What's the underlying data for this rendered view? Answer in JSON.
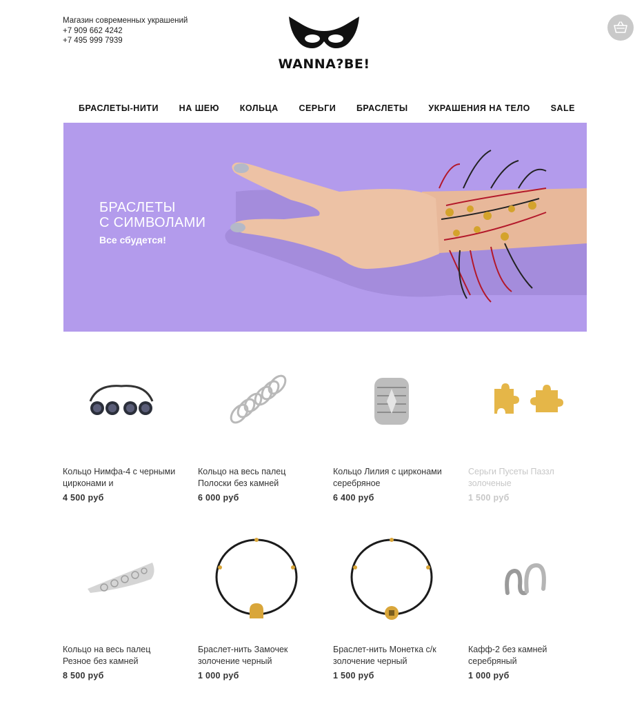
{
  "header": {
    "tagline": "Магазин современных украшений",
    "phone1": "+7 909 662 4242",
    "phone2": "+7 495 999 7939",
    "brand": "WANNA?BE!",
    "cart_icon": "basket-icon"
  },
  "nav": {
    "items": [
      {
        "label": "БРАСЛЕТЫ-НИТИ"
      },
      {
        "label": "НА ШЕЮ"
      },
      {
        "label": "КОЛЬЦА"
      },
      {
        "label": "СЕРЬГИ"
      },
      {
        "label": "БРАСЛЕТЫ"
      },
      {
        "label": "УКРАШЕНИЯ НА ТЕЛО"
      },
      {
        "label": "SALE"
      }
    ]
  },
  "banner": {
    "title_line1": "БРАСЛЕТЫ",
    "title_line2": "С СИМВОЛАМИ",
    "subtitle": "Все сбудется!",
    "background": "#b39bec"
  },
  "products": [
    {
      "name": "Кольцо Нимфа-4 с черными цирконами и",
      "price": "4 500 руб",
      "image": "double-pearl-ring"
    },
    {
      "name": "Кольцо на весь палец Полоски без камней",
      "price": "6 000 руб",
      "image": "striped-full-finger-ring"
    },
    {
      "name": "Кольцо Лилия с цирконами серебряное",
      "price": "6 400 руб",
      "image": "lily-zircon-ring"
    },
    {
      "name": "Серьги Пусеты Паззл золоченые",
      "price": "1 500 руб",
      "image": "puzzle-stud-earrings",
      "sold_out": true
    },
    {
      "name": "Кольцо на весь палец Резное без камней",
      "price": "8 500 руб",
      "image": "carved-full-finger-ring"
    },
    {
      "name": "Браслет-нить Замочек золочение черный",
      "price": "1 000 руб",
      "image": "lock-thread-bracelet"
    },
    {
      "name": "Браслет-нить Монетка с/к золочение черный",
      "price": "1 500 руб",
      "image": "coin-thread-bracelet"
    },
    {
      "name": "Кафф-2 без камней серебряный",
      "price": "1 000 руб",
      "image": "ear-cuff"
    }
  ]
}
